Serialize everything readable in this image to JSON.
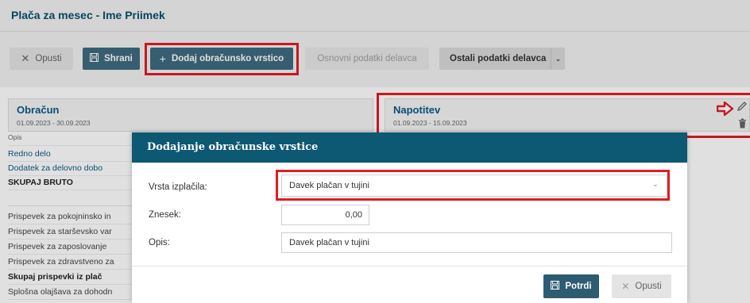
{
  "page": {
    "title": "Plača za mesec - Ime Priimek"
  },
  "toolbar": {
    "cancel": {
      "icon": "close-icon",
      "label": "Opusti"
    },
    "save": {
      "icon": "save-icon",
      "label": "Shrani"
    },
    "add_row": {
      "icon": "plus-icon",
      "label": "Dodaj obračunsko vrstico"
    },
    "employee_data": {
      "label": "Osnovni podatki delavca"
    },
    "other_data": {
      "label": "Ostali podatki delavca"
    }
  },
  "panels": {
    "obracun": {
      "title": "Obračun",
      "date": "01.09.2023 - 30.09.2023"
    },
    "napotitev": {
      "title": "Napotitev",
      "date": "01.09.2023 - 15.09.2023"
    }
  },
  "list": {
    "header": "Opis",
    "rows": [
      "Redno delo",
      "Dodatek za delovno dobo",
      "SKUPAJ BRUTO",
      "",
      "Prispevek za pokojninsko in",
      "Prispevek za starševsko var",
      "Prispevek za zaposlovanje",
      "Prispevek za zdravstveno za",
      "Skupaj prispevki iz plač",
      "Splošna olajšava za dohodn"
    ]
  },
  "modal": {
    "title": "Dodajanje obračunske vrstice",
    "fields": {
      "type": {
        "label": "Vrsta izplačila:",
        "value": "Davek plačan v tujini"
      },
      "amount": {
        "label": "Znesek:",
        "value": "0,00"
      },
      "description": {
        "label": "Opis:",
        "value": "Davek plačan v tujini"
      }
    },
    "buttons": {
      "confirm": {
        "icon": "save-icon",
        "label": "Potrdi"
      },
      "cancel": {
        "icon": "close-icon",
        "label": "Opusti"
      }
    }
  },
  "colors": {
    "accent_dark": "#0d5873",
    "highlight_red": "#e41b23",
    "link_blue": "#0b5a85"
  }
}
